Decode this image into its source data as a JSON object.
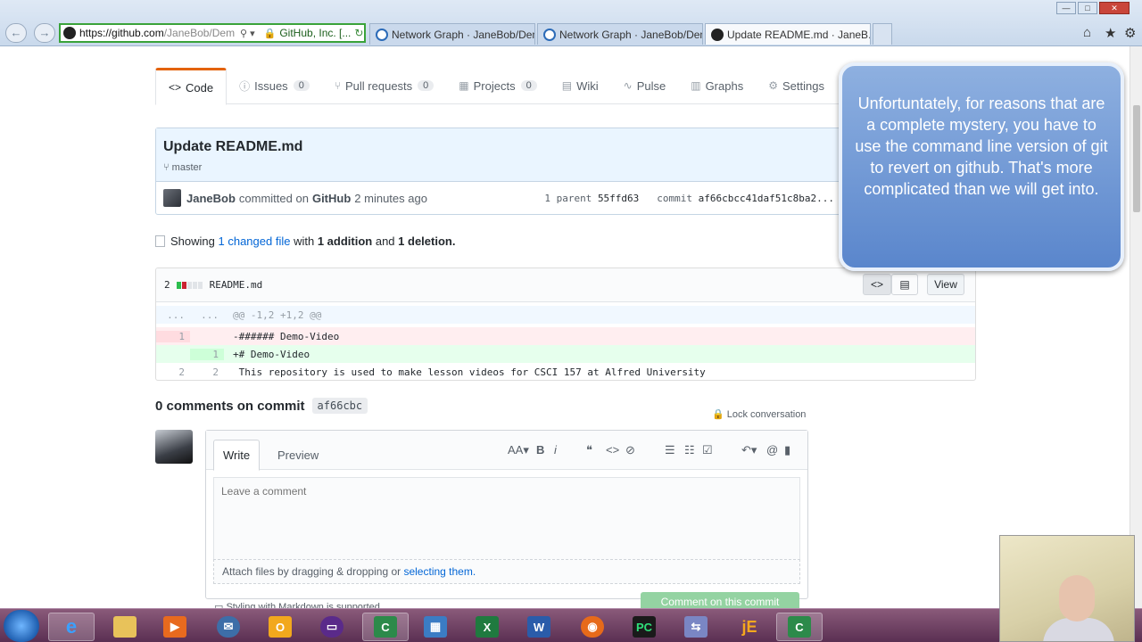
{
  "browser": {
    "url_main": "https://github.com",
    "url_rest": "/JaneBob/Dem",
    "site_identity": "GitHub, Inc. [...",
    "tabs": [
      {
        "label": "Network Graph · JaneBob/Dem..."
      },
      {
        "label": "Network Graph · JaneBob/Dem..."
      },
      {
        "label": "Update README.md · JaneB..."
      }
    ]
  },
  "repo": {
    "owner": "JaneBob",
    "name": "Demo-Video",
    "nav": [
      {
        "label": "Code",
        "glyph": "<>",
        "count": null
      },
      {
        "label": "Issues",
        "glyph": "ⓘ",
        "count": "0"
      },
      {
        "label": "Pull requests",
        "glyph": "⑂",
        "count": "0"
      },
      {
        "label": "Projects",
        "glyph": "▦",
        "count": "0"
      },
      {
        "label": "Wiki",
        "glyph": "▤",
        "count": null
      },
      {
        "label": "Pulse",
        "glyph": "∿",
        "count": null
      },
      {
        "label": "Graphs",
        "glyph": "▥",
        "count": null
      },
      {
        "label": "Settings",
        "glyph": "⚙",
        "count": null
      }
    ]
  },
  "commit": {
    "title": "Update README.md",
    "branch": "master",
    "author": "JaneBob",
    "committed_on": "committed on",
    "platform": "GitHub",
    "time": "2 minutes ago",
    "parent_label": "1 parent",
    "parent_sha": "55ffd63",
    "commit_label": "commit",
    "commit_sha": "af66cbcc41daf51c8ba2..."
  },
  "toc": {
    "showing": "Showing",
    "changed": "1 changed file",
    "with": "with",
    "additions": "1 addition",
    "and": "and",
    "deletions": "1 deletion."
  },
  "diff": {
    "stat_count": "2",
    "filename": "README.md",
    "view_label": "View",
    "hunk": "@@ -1,2 +1,2 @@",
    "lines": [
      {
        "type": "del",
        "old": "1",
        "new": "",
        "text": "-###### Demo-Video"
      },
      {
        "type": "add",
        "old": "",
        "new": "1",
        "text": "+# Demo-Video"
      },
      {
        "type": "ctx",
        "old": "2",
        "new": "2",
        "text": " This repository is used to make lesson videos for CSCI 157 at Alfred University"
      }
    ]
  },
  "comments": {
    "title": "0 comments on commit",
    "sha": "af66cbc",
    "lock": "Lock conversation",
    "tab_write": "Write",
    "tab_preview": "Preview",
    "placeholder": "Leave a comment",
    "attach_prefix": "Attach files by dragging & dropping or",
    "attach_link": "selecting them.",
    "markdown_hint": "Styling with Markdown is supported",
    "submit": "Comment on this commit"
  },
  "callout": {
    "text": "Unfortuntately, for reasons that are a complete mystery, you have to use the command line version of git to revert on github. That's more complicated than we will get into."
  },
  "colors": {
    "accent_tab": "#e36209",
    "link": "#0366d6",
    "add": "#e6ffed",
    "del": "#ffeef0"
  }
}
